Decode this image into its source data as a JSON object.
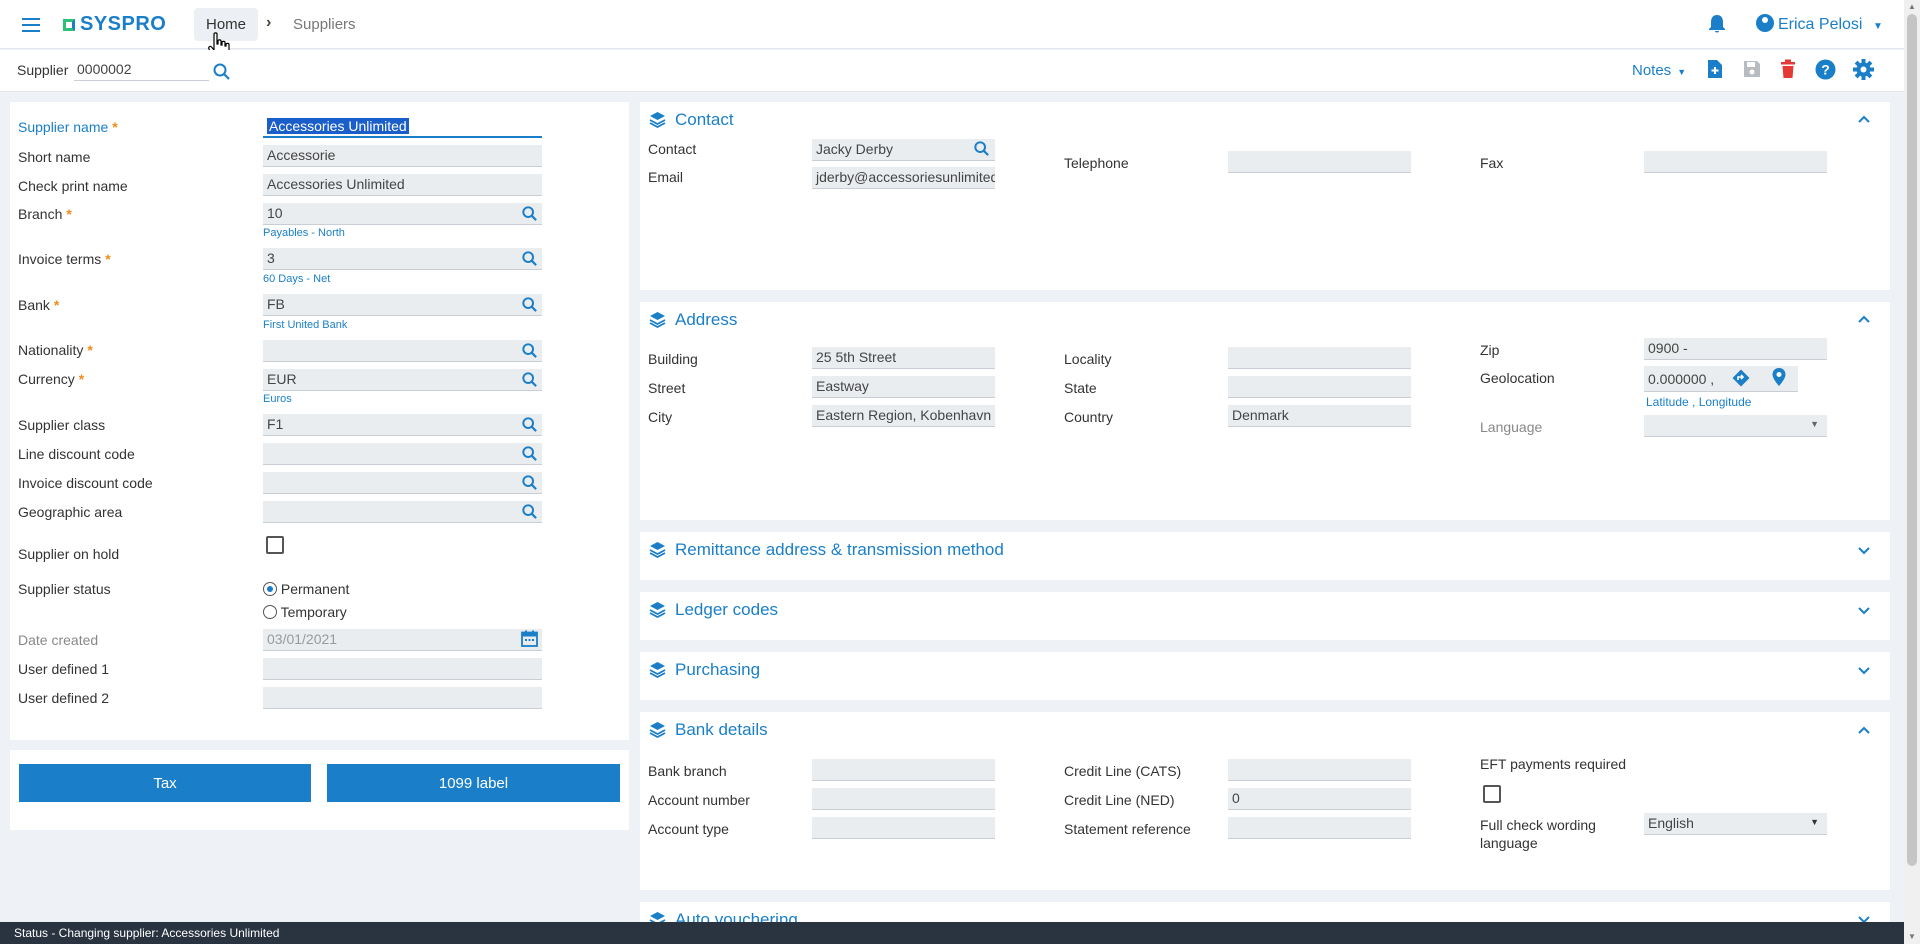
{
  "header": {
    "brand": "SYSPRO",
    "breadcrumb": {
      "home": "Home",
      "current": "Suppliers"
    },
    "user_name": "Erica Pelosi"
  },
  "toolbar": {
    "supplier_label": "Supplier",
    "supplier_value": "0000002",
    "notes_label": "Notes"
  },
  "form": {
    "supplier_name": {
      "label": "Supplier name",
      "value": "Accessories Unlimited"
    },
    "short_name": {
      "label": "Short name",
      "value": "Accessorie"
    },
    "check_print_name": {
      "label": "Check print name",
      "value": "Accessories Unlimited"
    },
    "branch": {
      "label": "Branch",
      "value": "10",
      "hint": "Payables - North"
    },
    "invoice_terms": {
      "label": "Invoice terms",
      "value": "3",
      "hint": "60 Days - Net"
    },
    "bank": {
      "label": "Bank",
      "value": "FB",
      "hint": "First United Bank"
    },
    "nationality": {
      "label": "Nationality",
      "value": ""
    },
    "currency": {
      "label": "Currency",
      "value": "EUR",
      "hint": "Euros"
    },
    "supplier_class": {
      "label": "Supplier class",
      "value": "F1"
    },
    "line_discount_code": {
      "label": "Line discount code",
      "value": ""
    },
    "invoice_discount_code": {
      "label": "Invoice discount code",
      "value": ""
    },
    "geographic_area": {
      "label": "Geographic area",
      "value": ""
    },
    "supplier_on_hold": {
      "label": "Supplier on hold"
    },
    "supplier_status": {
      "label": "Supplier status",
      "options": [
        "Permanent",
        "Temporary"
      ],
      "selected": "Permanent"
    },
    "date_created": {
      "label": "Date created",
      "value": "03/01/2021"
    },
    "user_defined_1": {
      "label": "User defined 1",
      "value": ""
    },
    "user_defined_2": {
      "label": "User defined 2",
      "value": ""
    }
  },
  "buttons": {
    "tax": "Tax",
    "label_1099": "1099 label"
  },
  "contact": {
    "title": "Contact",
    "contact_label": "Contact",
    "contact_value": "Jacky Derby",
    "email_label": "Email",
    "email_value": "jderby@accessoriesunlimited",
    "telephone_label": "Telephone",
    "fax_label": "Fax"
  },
  "address": {
    "title": "Address",
    "building_label": "Building",
    "building_value": "25 5th Street",
    "street_label": "Street",
    "street_value": "Eastway",
    "city_label": "City",
    "city_value": "Eastern Region, Kobenhavn",
    "locality_label": "Locality",
    "state_label": "State",
    "country_label": "Country",
    "country_value": "Denmark",
    "zip_label": "Zip",
    "zip_value": "0900 -",
    "geolocation_label": "Geolocation",
    "geolocation_value": "0.000000 ,",
    "geolocation_hint": "Latitude , Longitude",
    "language_label": "Language"
  },
  "sections": {
    "remittance": "Remittance address & transmission method",
    "ledger": "Ledger codes",
    "purchasing": "Purchasing",
    "auto_vouchering": "Auto vouchering"
  },
  "bank_details": {
    "title": "Bank details",
    "bank_branch_label": "Bank branch",
    "account_number_label": "Account number",
    "account_type_label": "Account type",
    "credit_cats_label": "Credit Line (CATS)",
    "credit_ned_label": "Credit Line (NED)",
    "credit_ned_value": "0",
    "statement_ref_label": "Statement reference",
    "eft_label": "EFT payments required",
    "full_check_label": "Full check wording language",
    "full_check_value": "English"
  },
  "status": "Status - Changing supplier: Accessories Unlimited"
}
